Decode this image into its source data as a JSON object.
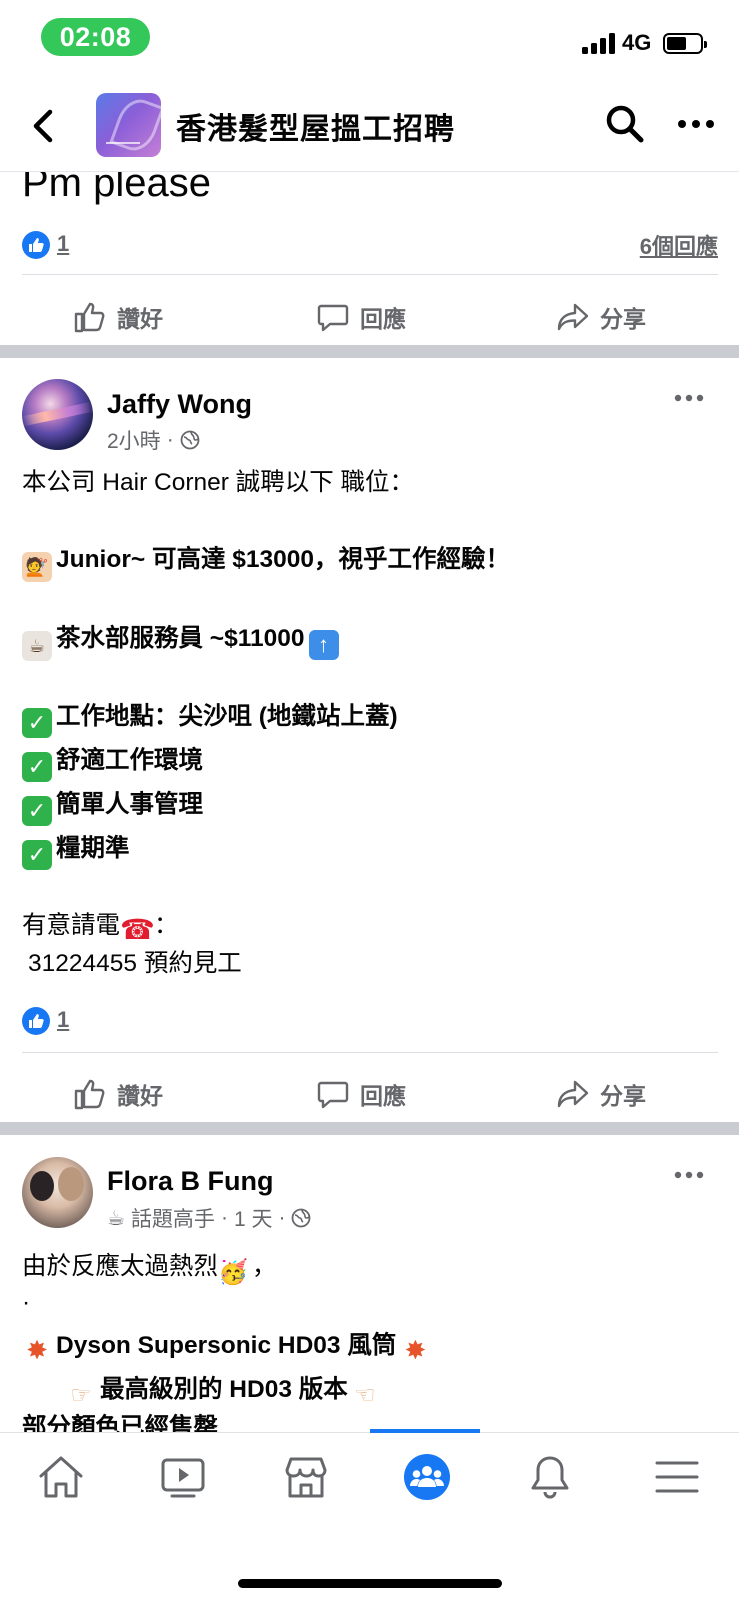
{
  "status_bar": {
    "time": "02:08",
    "network": "4G"
  },
  "header": {
    "group_name": "香港髮型屋搵工招聘"
  },
  "prev_post": {
    "text": "Pm please",
    "like_count": "1",
    "comments": "6個回應"
  },
  "actions": {
    "like": "讚好",
    "comment": "回應",
    "share": "分享"
  },
  "post1": {
    "author": "Jaffy Wong",
    "time": "2小時",
    "lines": [
      "本公司 Hair Corner 誠聘以下 職位：",
      "Junior~ 可高達 $13000，視乎工作經驗！",
      "茶水部服務員 ~$11000",
      "工作地點：尖沙咀 (地鐵站上蓋)",
      "舒適工作環境",
      "簡單人事管理",
      "糧期準",
      "有意請電",
      "31224455 預約見工"
    ],
    "like_count": "1"
  },
  "post2": {
    "author": "Flora B Fung",
    "badge": "話題高手",
    "time": "1 天",
    "lines": [
      "由於反應太過熱烈",
      "·",
      "Dyson Supersonic HD03 風筒",
      "最高級別的 HD03 版本",
      "部分顏色已經售罄"
    ]
  },
  "colors": {
    "brand": "#1877f2",
    "status_green": "#34c759",
    "separator": "#c9ccd1"
  },
  "nav": {
    "items": [
      "home-icon",
      "watch-icon",
      "marketplace-icon",
      "groups-icon",
      "notifications-icon",
      "menu-icon"
    ]
  }
}
